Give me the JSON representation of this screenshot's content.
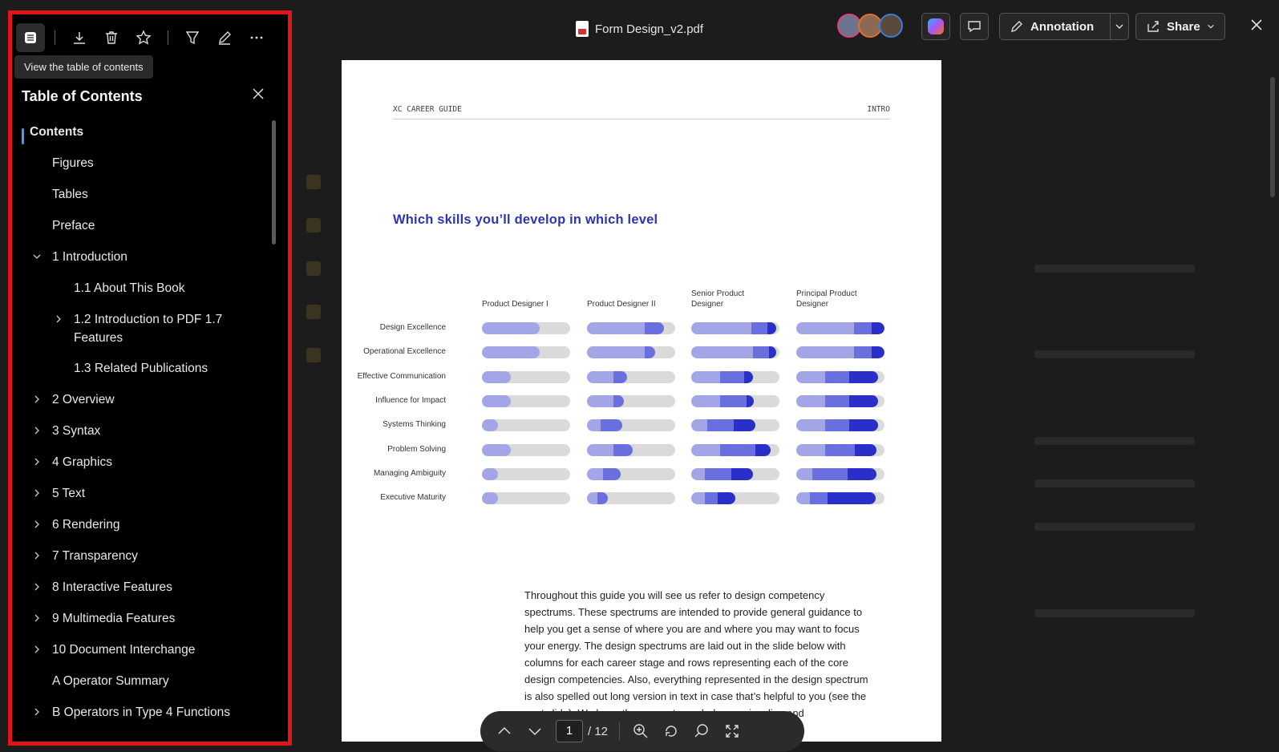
{
  "file": {
    "name": "Form Design_v2.pdf"
  },
  "header": {
    "annotation_label": "Annotation",
    "share_label": "Share"
  },
  "panel": {
    "tooltip": "View the table of contents",
    "title": "Table of Contents",
    "items": [
      {
        "label": "Contents",
        "level": 0,
        "chevron": "none",
        "active": true
      },
      {
        "label": "Figures",
        "level": 1,
        "chevron": "none"
      },
      {
        "label": "Tables",
        "level": 1,
        "chevron": "none"
      },
      {
        "label": "Preface",
        "level": 1,
        "chevron": "none"
      },
      {
        "label": "1 Introduction",
        "level": 1,
        "chevron": "down"
      },
      {
        "label": "1.1 About This Book",
        "level": 2,
        "chevron": "none"
      },
      {
        "label": "1.2 Introduction to PDF 1.7 Features",
        "level": 2,
        "chevron": "right"
      },
      {
        "label": "1.3 Related Publications",
        "level": 2,
        "chevron": "none"
      },
      {
        "label": "2 Overview",
        "level": 1,
        "chevron": "right"
      },
      {
        "label": "3 Syntax",
        "level": 1,
        "chevron": "right"
      },
      {
        "label": "4 Graphics",
        "level": 1,
        "chevron": "right"
      },
      {
        "label": "5 Text",
        "level": 1,
        "chevron": "right"
      },
      {
        "label": "6 Rendering",
        "level": 1,
        "chevron": "right"
      },
      {
        "label": "7 Transparency",
        "level": 1,
        "chevron": "right"
      },
      {
        "label": "8 Interactive Features",
        "level": 1,
        "chevron": "right"
      },
      {
        "label": "9 Multimedia Features",
        "level": 1,
        "chevron": "right"
      },
      {
        "label": "10 Document Interchange",
        "level": 1,
        "chevron": "right"
      },
      {
        "label": "A Operator Summary",
        "level": 1,
        "chevron": "none"
      },
      {
        "label": "B Operators in Type 4 Functions",
        "level": 1,
        "chevron": "right"
      }
    ]
  },
  "page": {
    "header_left": "XC CAREER GUIDE",
    "header_right": "INTRO",
    "heading": "Which skills you’ll develop in which level",
    "columns": [
      "Product Designer I",
      "Product Designer II",
      "Senior Product Designer",
      "Principal Product Designer"
    ],
    "rows": [
      "Design Excellence",
      "Operational Excellence",
      "Effective Communication",
      "Influence for Impact",
      "Systems Thinking",
      "Problem Solving",
      "Managing Ambiguity",
      "Executive Maturity"
    ],
    "levels": [
      [
        [
          0.65,
          0,
          0
        ],
        [
          0.65,
          0.22,
          0
        ],
        [
          0.68,
          0.18,
          0.1
        ],
        [
          0.65,
          0.2,
          0.15
        ]
      ],
      [
        [
          0.65,
          0,
          0
        ],
        [
          0.65,
          0.12,
          0
        ],
        [
          0.7,
          0.18,
          0.08
        ],
        [
          0.65,
          0.2,
          0.15
        ]
      ],
      [
        [
          0.33,
          0,
          0
        ],
        [
          0.3,
          0.15,
          0
        ],
        [
          0.33,
          0.27,
          0.1
        ],
        [
          0.33,
          0.27,
          0.33
        ]
      ],
      [
        [
          0.33,
          0,
          0
        ],
        [
          0.3,
          0.12,
          0
        ],
        [
          0.33,
          0.3,
          0.08
        ],
        [
          0.33,
          0.27,
          0.33
        ]
      ],
      [
        [
          0.18,
          0,
          0
        ],
        [
          0.15,
          0.25,
          0
        ],
        [
          0.18,
          0.3,
          0.25
        ],
        [
          0.33,
          0.27,
          0.33
        ]
      ],
      [
        [
          0.33,
          0,
          0
        ],
        [
          0.3,
          0.22,
          0
        ],
        [
          0.33,
          0.4,
          0.17
        ],
        [
          0.33,
          0.33,
          0.25
        ]
      ],
      [
        [
          0.18,
          0,
          0
        ],
        [
          0.18,
          0.2,
          0
        ],
        [
          0.15,
          0.3,
          0.25
        ],
        [
          0.18,
          0.4,
          0.33
        ]
      ],
      [
        [
          0.18,
          0,
          0
        ],
        [
          0.12,
          0.12,
          0
        ],
        [
          0.15,
          0.15,
          0.2
        ],
        [
          0.15,
          0.2,
          0.55
        ]
      ]
    ],
    "paragraph": "Throughout this guide you will see us refer to design competency spectrums. These spectrums are intended to provide general guidance to help you get a sense of where you are and where you may want to focus your energy. The design spectrums are laid out in the slide below with columns for each career stage and rows representing each of the core design competencies. Also, everything represented in the design spectrum is also spelled out long version in text in case that’s helpful to you (see the next slide). We hope these spectrums help you visualize and"
  },
  "nav": {
    "current_page": "1",
    "total_pages": "/ 12"
  },
  "colors": {
    "light": "#a3a6e6",
    "mid": "#6a6fe0",
    "dark": "#2b2fc9",
    "panel_border": "#e0151a",
    "accent": "#4a9af5"
  }
}
